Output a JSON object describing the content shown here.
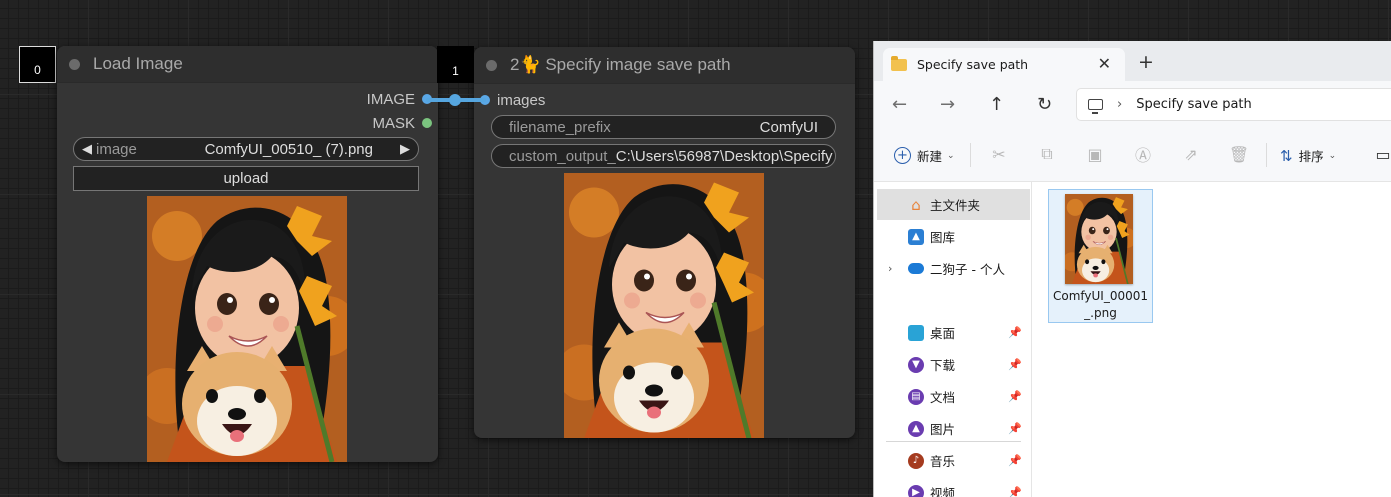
{
  "canvas": {
    "node_ids": [
      "0",
      "1"
    ],
    "load_image_node": {
      "title": "Load Image",
      "outputs": [
        {
          "label": "IMAGE",
          "color": "#5aa7e6"
        },
        {
          "label": "MASK",
          "color": "#7bc47f"
        }
      ],
      "image_widget": {
        "label": "image",
        "value": "ComfyUI_00510_ (7).png",
        "prev_arrow": "◀",
        "next_arrow": "▶"
      },
      "upload_label": "upload"
    },
    "save_path_node": {
      "title": "2🐈 Specify image save path",
      "inputs": [
        {
          "label": "images",
          "color": "#5aa7e6"
        }
      ],
      "widgets": [
        {
          "label": "filename_prefix",
          "value": "ComfyUI"
        },
        {
          "label": "custom_output_",
          "value": "C:\\Users\\56987\\Desktop\\Specify"
        }
      ]
    },
    "link_color": "#56a6e0"
  },
  "explorer": {
    "tab_title": "Specify save path",
    "tab_close": "✕",
    "new_tab": "+",
    "nav": {
      "back": "←",
      "forward": "→",
      "up": "↑",
      "refresh": "↻",
      "chevron": "›"
    },
    "address": "Specify save path",
    "toolbar": {
      "new_label": "新建",
      "sort_label": "排序"
    },
    "sidebar": {
      "items": [
        {
          "label": "主文件夹",
          "icon": "home-icon",
          "color": "#e8833a"
        },
        {
          "label": "图库",
          "icon": "gallery-icon",
          "color": "#2b7fd3"
        },
        {
          "label": "二狗子 - 个人",
          "icon": "onedrive-icon",
          "color": "#1b7ad6"
        },
        {
          "label": "桌面",
          "icon": "desktop-icon",
          "color": "#29a3d6"
        },
        {
          "label": "下载",
          "icon": "download-icon",
          "color": "#6a3cb0"
        },
        {
          "label": "文档",
          "icon": "documents-icon",
          "color": "#6a3cb0"
        },
        {
          "label": "图片",
          "icon": "pictures-icon",
          "color": "#6a3cb0"
        },
        {
          "label": "音乐",
          "icon": "music-icon",
          "color": "#a53b1f"
        },
        {
          "label": "视频",
          "icon": "videos-icon",
          "color": "#6a3cb0"
        }
      ]
    },
    "files": [
      {
        "name_line1": "ComfyUI_00001",
        "name_line2": "_.png"
      }
    ]
  }
}
